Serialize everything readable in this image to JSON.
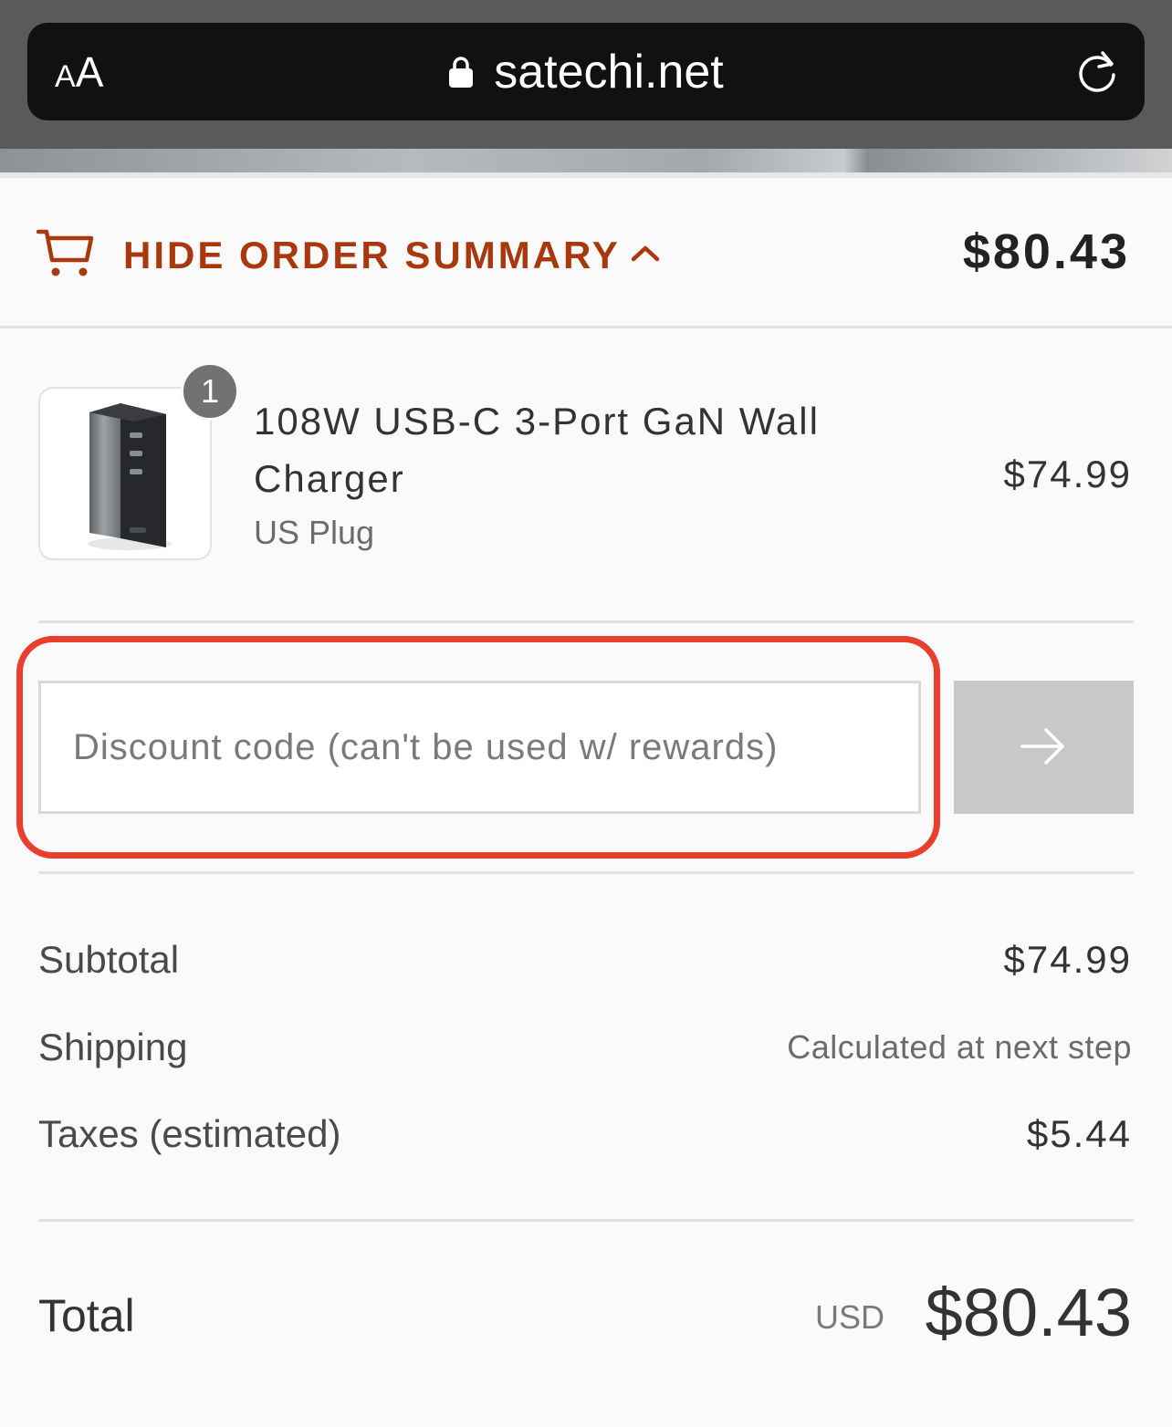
{
  "browser": {
    "text_size_label": "A",
    "text_size_label_large": "A",
    "url": "satechi.net"
  },
  "summary_toggle": {
    "label": "HIDE ORDER SUMMARY",
    "total": "$80.43"
  },
  "line_items": [
    {
      "name": "108W USB-C 3-Port GaN Wall Charger",
      "variant": "US Plug",
      "quantity": "1",
      "price": "$74.99"
    }
  ],
  "discount": {
    "placeholder": "Discount code (can't be used w/ rewards)",
    "value": ""
  },
  "costs": {
    "subtotal_label": "Subtotal",
    "subtotal_value": "$74.99",
    "shipping_label": "Shipping",
    "shipping_value": "Calculated at next step",
    "taxes_label": "Taxes (estimated)",
    "taxes_value": "$5.44"
  },
  "total": {
    "label": "Total",
    "currency": "USD",
    "amount": "$80.43"
  },
  "colors": {
    "accent": "#a9380d",
    "highlight": "#e8402c",
    "apply_button": "#c8c8c8"
  },
  "icons": [
    "lock-icon",
    "reload-icon",
    "cart-icon",
    "chevron-up-icon",
    "arrow-right-icon"
  ]
}
